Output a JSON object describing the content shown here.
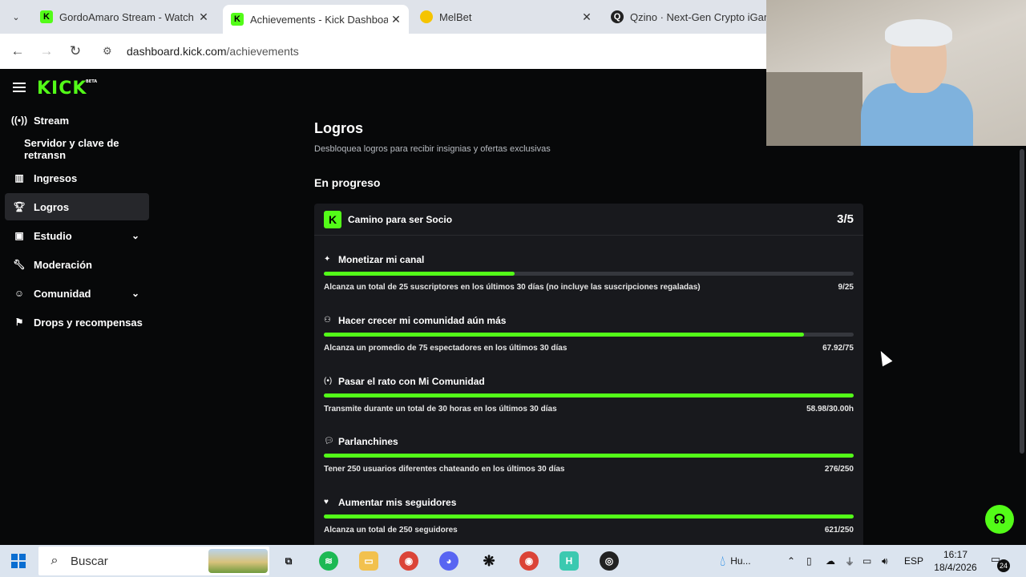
{
  "browser": {
    "tabs": [
      {
        "label": "GordoAmaro Stream - Watch Li",
        "favicon": "kick-icon",
        "active": false
      },
      {
        "label": "Achievements - Kick Dashboard",
        "favicon": "kick-icon",
        "active": true
      },
      {
        "label": "MelBet",
        "favicon": "melbet-icon",
        "active": false
      },
      {
        "label": "Qzino · Next-Gen Crypto iGami",
        "favicon": "qzino-icon",
        "active": false
      }
    ],
    "url_domain": "dashboard.kick.com",
    "url_path": "/achievements"
  },
  "sidebar": {
    "logo": "KICK",
    "logo_badge": "BETA",
    "items": [
      {
        "label": "Stream",
        "icon": "broadcast-icon"
      },
      {
        "label": "Servidor y clave de retransn",
        "icon": ""
      },
      {
        "label": "Ingresos",
        "icon": "chart-icon"
      },
      {
        "label": "Logros",
        "icon": "trophy-icon",
        "active": true
      },
      {
        "label": "Estudio",
        "icon": "studio-icon",
        "expandable": true
      },
      {
        "label": "Moderación",
        "icon": "wrench-icon"
      },
      {
        "label": "Comunidad",
        "icon": "community-icon",
        "expandable": true
      },
      {
        "label": "Drops y recompensas",
        "icon": "gift-icon"
      }
    ]
  },
  "main": {
    "title": "Logros",
    "subtitle": "Desbloquea logros para recibir insignias y ofertas exclusivas",
    "section": "En progreso",
    "card": {
      "title": "Camino para ser Socio",
      "count": "3/5",
      "achievements": [
        {
          "title": "Monetizar mi canal",
          "icon": "sparkle-icon",
          "desc": "Alcanza un total de 25 suscriptores en los últimos 30 días (no incluye las suscripciones regaladas)",
          "value": "9/25",
          "progress": 0.36
        },
        {
          "title": "Hacer crecer mi comunidad aún más",
          "icon": "users-icon",
          "desc": "Alcanza un promedio de 75 espectadores en los últimos 30 días",
          "value": "67.92/75",
          "progress": 0.906
        },
        {
          "title": "Pasar el rato con Mi Comunidad",
          "icon": "broadcast-icon",
          "desc": "Transmite durante un total de 30 horas en los últimos 30 días",
          "value": "58.98/30.00h",
          "progress": 1.0
        },
        {
          "title": "Parlanchines",
          "icon": "chat-icon",
          "desc": "Tener 250 usuarios diferentes chateando en los últimos 30 días",
          "value": "276/250",
          "progress": 1.0
        },
        {
          "title": "Aumentar mis seguidores",
          "icon": "heart-icon",
          "desc": "Alcanza un total de 250 seguidores",
          "value": "621/250",
          "progress": 1.0
        }
      ]
    }
  },
  "taskbar": {
    "search_placeholder": "Buscar",
    "weather": "Hu...",
    "language": "ESP",
    "time": "16:17",
    "date": "18/4/2026",
    "notifications": "24"
  },
  "colors": {
    "accent": "#53fc18",
    "background": "#070809",
    "card": "#18191d"
  }
}
